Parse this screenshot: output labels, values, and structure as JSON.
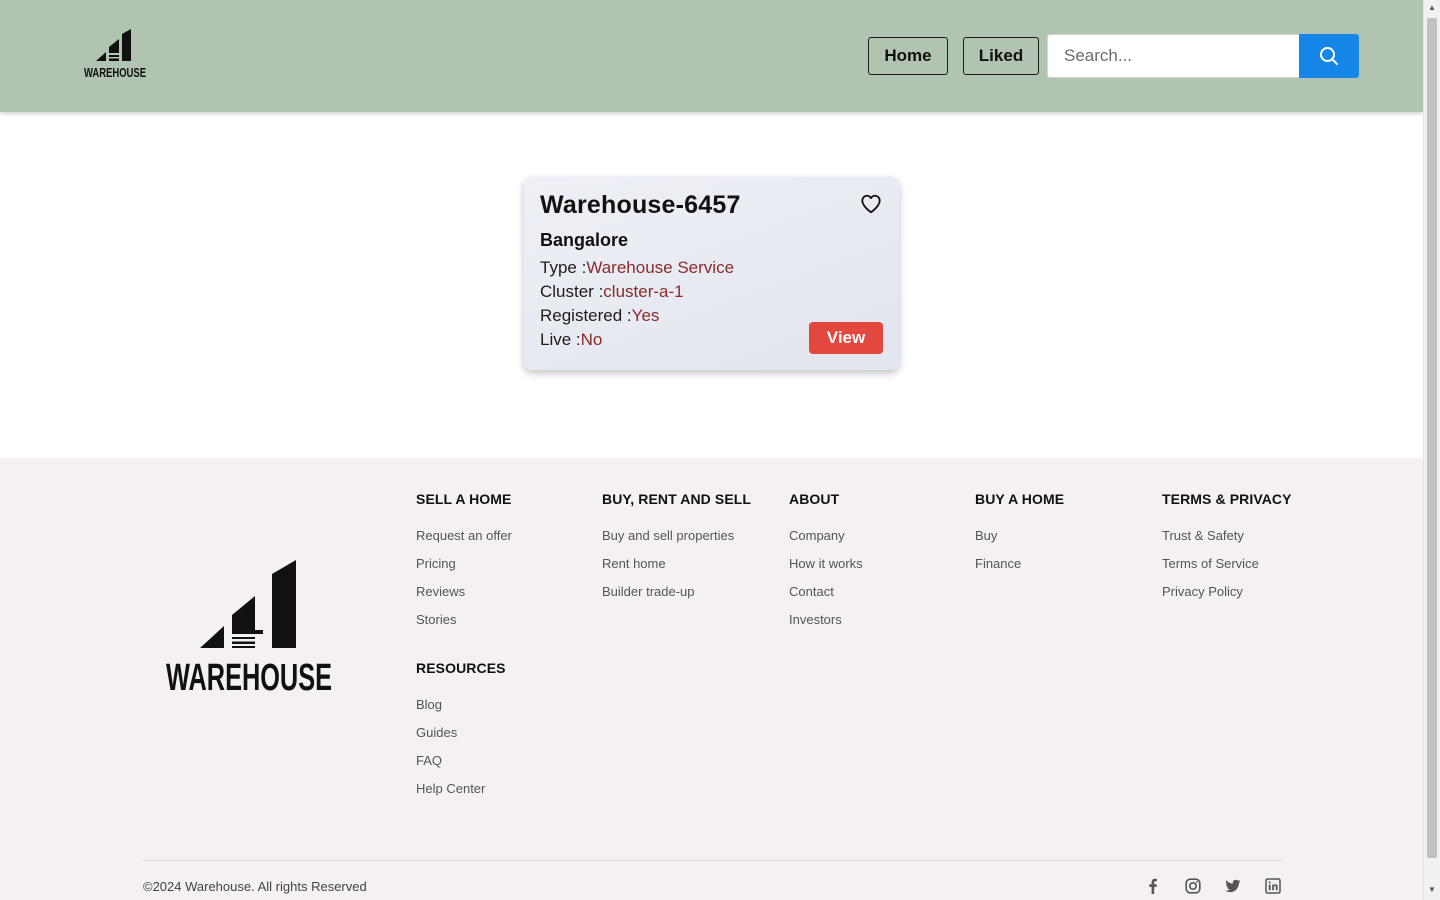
{
  "header": {
    "logo": "warehouse-logo",
    "nav": {
      "home_label": "Home",
      "liked_label": "Liked"
    },
    "search": {
      "placeholder": "Search...",
      "icon": "search-icon"
    },
    "background": "#b0c4b1",
    "search_button_color": "#1685e8"
  },
  "card": {
    "title": "Warehouse-6457",
    "city": "Bangalore",
    "favorite_icon": "heart-icon",
    "type_label": "Type :",
    "type_value": "Warehouse Service",
    "cluster_label": "Cluster :",
    "cluster_value": "cluster-a-1",
    "registered_label": "Registered :",
    "registered_value": "Yes",
    "live_label": "Live :",
    "live_value": "No",
    "view_label": "View",
    "view_color": "#e2483d",
    "value_color": "#8a2b2b"
  },
  "footer": {
    "logo": "warehouse-logo",
    "columns": [
      {
        "heading": "SELL A HOME",
        "links": [
          "Request an offer",
          "Pricing",
          "Reviews",
          "Stories"
        ]
      },
      {
        "heading": "BUY, RENT AND SELL",
        "links": [
          "Buy and sell properties",
          "Rent home",
          "Builder trade-up"
        ]
      },
      {
        "heading": "ABOUT",
        "links": [
          "Company",
          "How it works",
          "Contact",
          "Investors"
        ]
      },
      {
        "heading": "BUY A HOME",
        "links": [
          "Buy",
          "Finance"
        ]
      },
      {
        "heading": "TERMS & PRIVACY",
        "links": [
          "Trust & Safety",
          "Terms of Service",
          "Privacy Policy"
        ]
      },
      {
        "heading": "RESOURCES",
        "links": [
          "Blog",
          "Guides",
          "FAQ",
          "Help Center"
        ]
      }
    ],
    "copyright": "©2024 Warehouse. All rights Reserved",
    "social_icons": [
      "facebook-icon",
      "instagram-icon",
      "twitter-icon",
      "linkedin-icon"
    ],
    "background": "#f4f1f0"
  }
}
